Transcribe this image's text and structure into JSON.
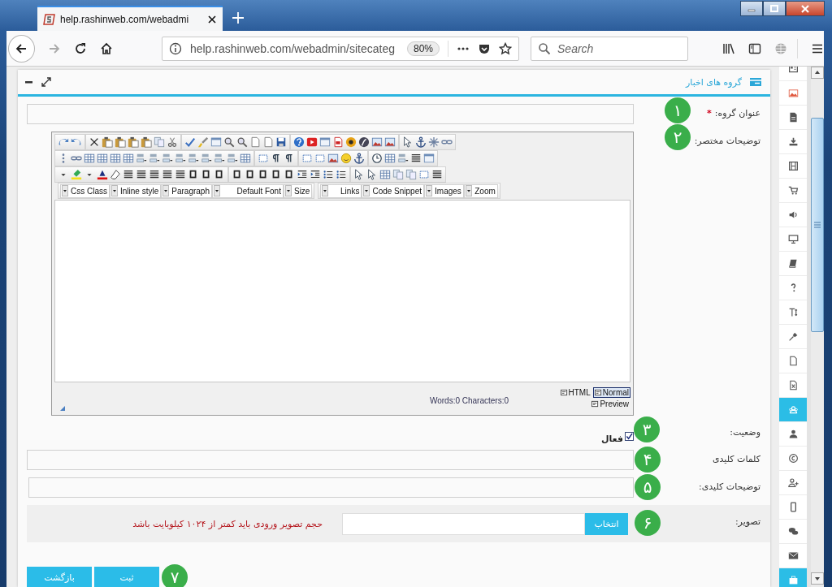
{
  "browser": {
    "tab_title": "help.rashinweb.com/webadmi",
    "url": "help.rashinweb.com/webadmin/sitecateg",
    "zoom": "80%",
    "search": {
      "placeholder": "Search"
    }
  },
  "panel": {
    "title": "گروه های اخبار"
  },
  "form": {
    "group_title": {
      "label": "عنوان گروه:",
      "required_mark": "*",
      "badge": "۱"
    },
    "summary": {
      "label": "توضیحات مختصر:",
      "badge": "۲"
    },
    "editor": {
      "dropdown_groups": [
        [
          "Zoom",
          "Images",
          "Code Snippet",
          "Links"
        ],
        [
          "Size",
          "Default Font",
          "Paragraph",
          "Inline style",
          "Css Class"
        ]
      ],
      "counter": "Words:0 Characters:0",
      "modes": [
        {
          "label": "HTML",
          "selected": false
        },
        {
          "label": "Normal",
          "selected": true
        },
        {
          "label": "Preview",
          "selected": false
        }
      ]
    },
    "status": {
      "label": "وضعیت:",
      "option": "فعال",
      "checked": true,
      "badge": "۳"
    },
    "keywords": {
      "label": "کلمات کلیدی",
      "badge": "۴"
    },
    "meta_description": {
      "label": "توضیحات کلیدی:",
      "badge": "۵"
    },
    "image": {
      "label": "تصویر:",
      "button": "انتخاب",
      "hint": "حجم تصویر ورودی باید کمتر از ۱۰۲۴ کیلوبایت باشد",
      "badge": "۶"
    },
    "actions": {
      "buttons": [
        "ثبت",
        "بازگشت"
      ],
      "badge": "۷"
    }
  },
  "sidebar": {
    "items": [
      {
        "selected": false
      },
      {
        "selected": false
      },
      {
        "selected": false
      },
      {
        "selected": false
      },
      {
        "selected": false
      },
      {
        "selected": false
      },
      {
        "selected": false
      },
      {
        "selected": false
      },
      {
        "selected": false
      },
      {
        "selected": false
      },
      {
        "selected": false
      },
      {
        "selected": false
      },
      {
        "selected": false
      },
      {
        "selected": false
      },
      {
        "selected": true
      },
      {
        "selected": false
      },
      {
        "selected": false
      },
      {
        "selected": false
      },
      {
        "selected": false
      },
      {
        "selected": false
      },
      {
        "selected": false
      },
      {
        "selected": true
      }
    ]
  }
}
